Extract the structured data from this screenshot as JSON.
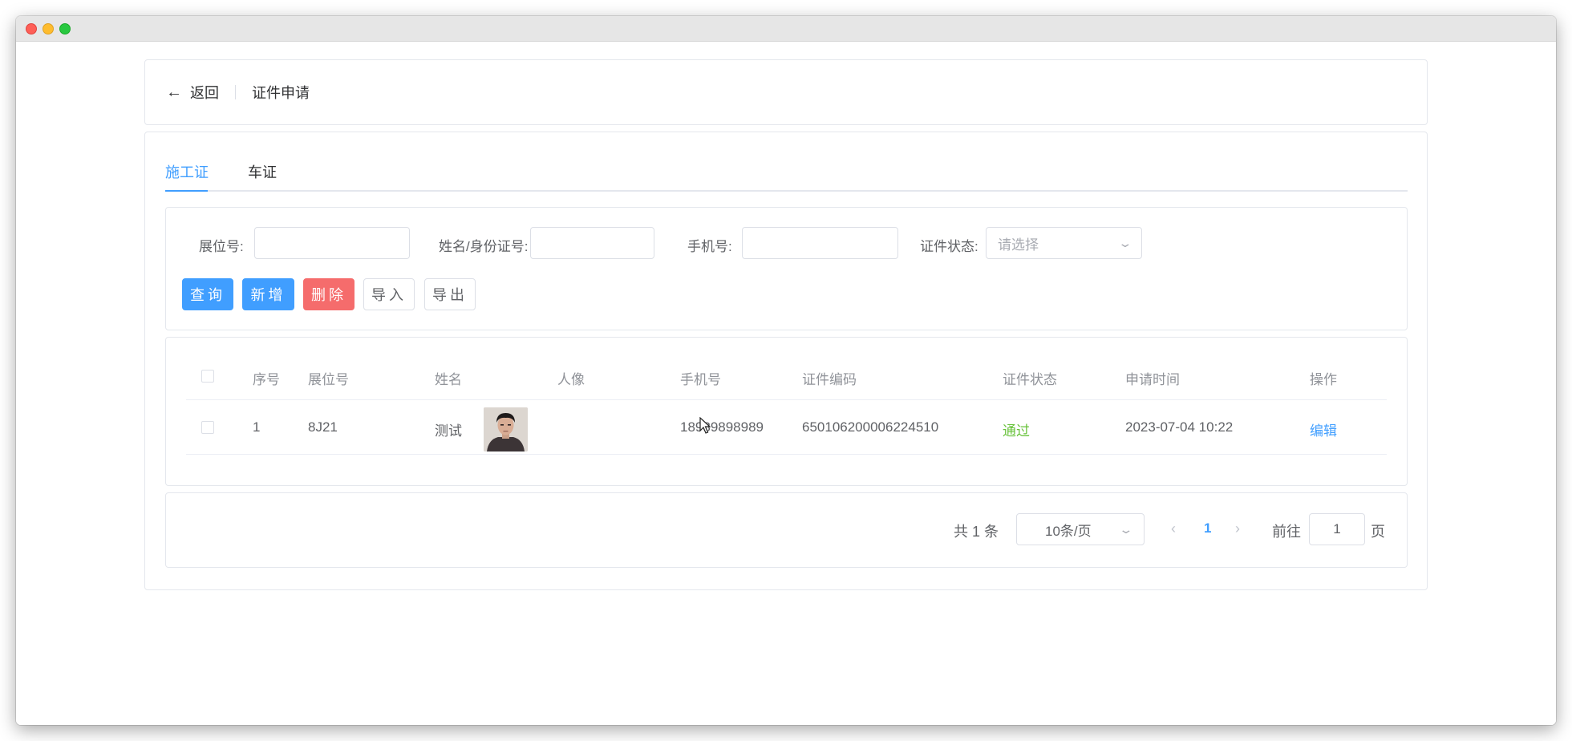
{
  "header": {
    "back_label": "返回",
    "title": "证件申请"
  },
  "tabs": [
    {
      "label": "施工证",
      "active": true
    },
    {
      "label": "车证",
      "active": false
    }
  ],
  "filters": {
    "booth_label": "展位号:",
    "booth_value": "",
    "name_label": "姓名/身份证号:",
    "name_value": "",
    "phone_label": "手机号:",
    "phone_value": "",
    "status_label": "证件状态:",
    "status_placeholder": "请选择"
  },
  "buttons": {
    "query": "查询",
    "add": "新增",
    "delete": "删除",
    "import": "导入",
    "export": "导出"
  },
  "table": {
    "columns": [
      "序号",
      "展位号",
      "姓名",
      "人像",
      "手机号",
      "证件编码",
      "证件状态",
      "申请时间",
      "操作"
    ],
    "rows": [
      {
        "index": "1",
        "booth": "8J21",
        "name": "测试",
        "phone": "18989898989",
        "code": "650106200006224510",
        "status": "通过",
        "time": "2023-07-04 10:22",
        "action": "编辑"
      }
    ]
  },
  "pagination": {
    "total_label": "共 1 条",
    "page_size": "10条/页",
    "current_page": "1",
    "goto_label": "前往",
    "goto_value": "1",
    "page_suffix": "页"
  },
  "colors": {
    "primary": "#409eff",
    "danger": "#f56c6c",
    "success": "#67c23a"
  },
  "icons": {
    "back": "arrow-left-icon",
    "select": "chevron-down-icon",
    "prev": "chevron-left-icon",
    "next": "chevron-right-icon"
  }
}
